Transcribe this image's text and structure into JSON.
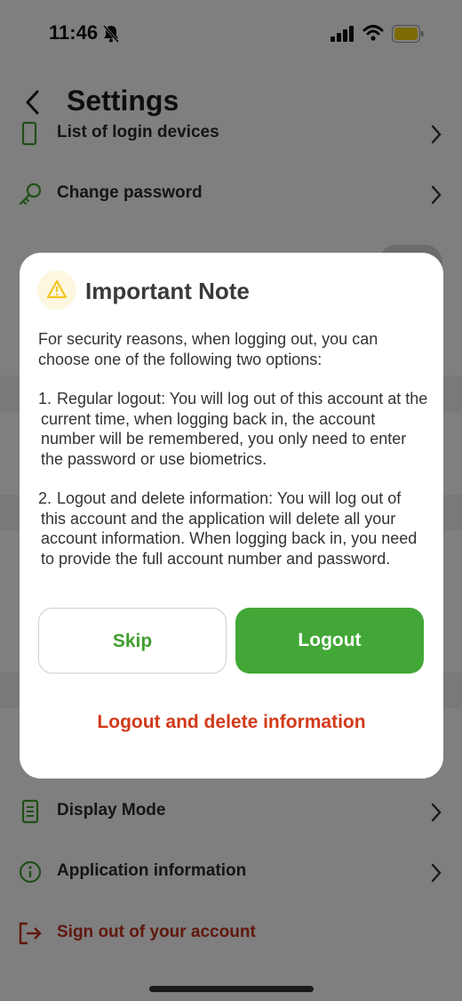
{
  "status_bar": {
    "time": "11:46"
  },
  "header": {
    "title": "Settings"
  },
  "settings": {
    "row_login_devices": "List of login devices",
    "row_change_password": "Change password",
    "row_display_mode": "Display Mode",
    "row_app_info": "Application information",
    "row_sign_out": "Sign out of your account"
  },
  "dialog": {
    "title": "Important Note",
    "intro": "For security reasons, when logging out, you can choose one of the following two options:",
    "item1_num": "1.",
    "item1_text": "Regular logout: You will log out of this account at the current time, when logging back in, the account number will be remembered, you only need to enter the password or use biometrics.",
    "item2_num": "2.",
    "item2_text": "Logout and delete information: You will log out of this account and the application will delete all your account information. When logging back in, you need to provide the full account number and password.",
    "skip_label": "Skip",
    "logout_label": "Logout",
    "delete_label": "Logout and delete information"
  },
  "colors": {
    "primary_green": "#42a736",
    "danger_red": "#d23a1a",
    "warning_yellow": "#f3c623",
    "battery_yellow": "#ffd60a"
  },
  "icons": [
    "bell-slash-icon",
    "signal-icon",
    "wifi-icon",
    "battery-icon",
    "back-chevron-icon",
    "key-icon",
    "phone-icon",
    "info-icon",
    "sign-out-icon",
    "warning-icon",
    "chevron-right-icon"
  ]
}
